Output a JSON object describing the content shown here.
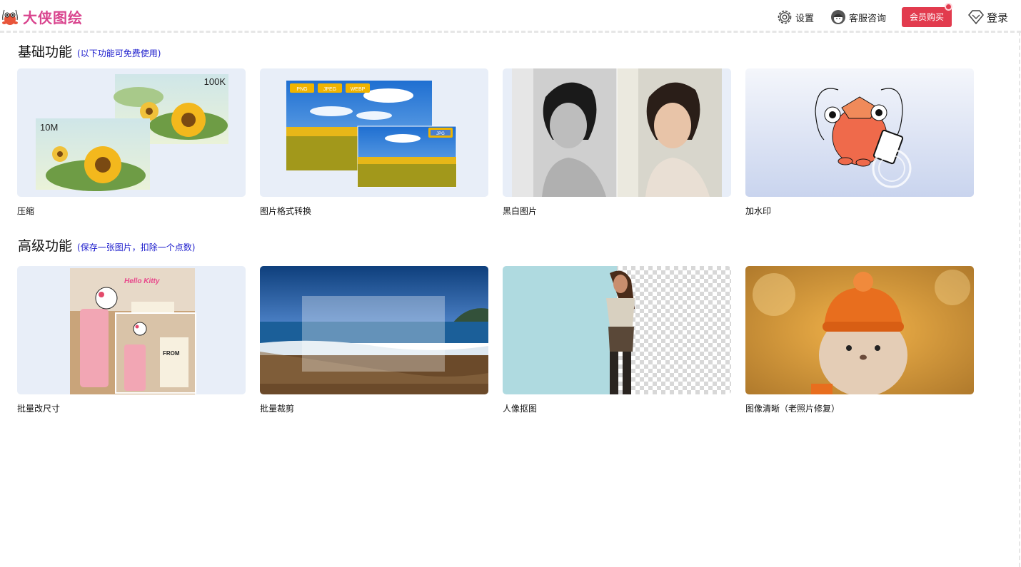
{
  "app": {
    "title": "大侠图绘"
  },
  "header": {
    "settings": "设置",
    "support": "客服咨询",
    "vip": "会员购买",
    "login": "登录"
  },
  "sections": [
    {
      "title": "基础功能",
      "subtitle": "(以下功能可免费使用)",
      "cards": [
        {
          "label": "压缩",
          "badge_small": "10M",
          "badge_large": "100K",
          "icon": "sunflower-compress-image"
        },
        {
          "label": "图片格式转换",
          "formats": [
            "PNG",
            "JPEG",
            "WEBP"
          ],
          "format_target": "JPG",
          "icon": "sunflower-field-image"
        },
        {
          "label": "黑白图片",
          "icon": "bw-colorize-portrait-image"
        },
        {
          "label": "加水印",
          "icon": "crayfish-mascot-image"
        }
      ]
    },
    {
      "title": "高级功能",
      "subtitle": "(保存一张图片，扣除一个点数)",
      "cards": [
        {
          "label": "批量改尺寸",
          "brand_text": "Hello Kitty",
          "cup_text": "FROM",
          "icon": "hello-kitty-cups-image"
        },
        {
          "label": "批量裁剪",
          "icon": "beach-crop-image"
        },
        {
          "label": "人像抠图",
          "icon": "portrait-cutout-image"
        },
        {
          "label": "图像清晰（老照片修复）",
          "icon": "hamster-hat-image"
        }
      ]
    }
  ],
  "colors": {
    "brand": "#d9448e",
    "vip": "#e23b4e",
    "subtitle": "#1a1acc",
    "card_bg": "#e8eef8"
  }
}
